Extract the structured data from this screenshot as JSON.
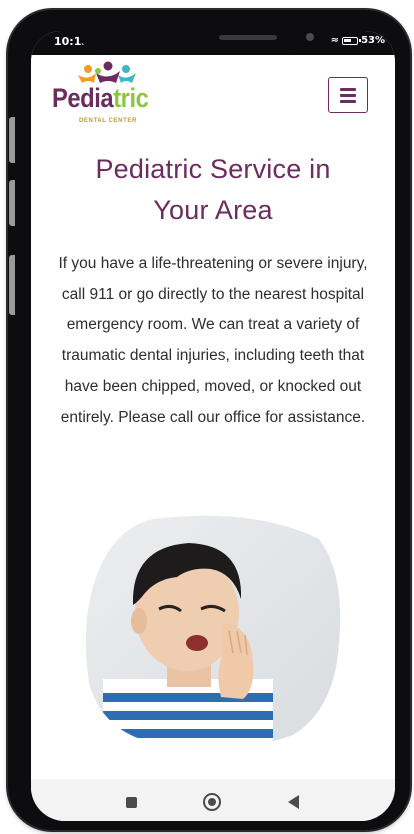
{
  "status_bar": {
    "time": "10:15",
    "battery": "53%",
    "icons": [
      "notification-icon",
      "wifi-icon",
      "battery-icon"
    ]
  },
  "header": {
    "logo_text": "Pediatric",
    "logo_subtitle": "DENTAL CENTER",
    "menu_icon": "hamburger-menu-icon"
  },
  "main": {
    "headline": "Pediatric Service in Your Area",
    "body": "If you have a life-threatening or severe injury, call 911 or go directly to the nearest hospital emergency room. We can treat a variety of traumatic dental injuries, including teeth that have been chipped, moved, or knocked out entirely. Please call our office for assistance.",
    "image": "child-with-toothache-photo"
  },
  "nav_bar": {
    "icons": [
      "recent-apps-icon",
      "home-icon",
      "back-icon"
    ]
  },
  "colors": {
    "brand_purple": "#6b2c5f",
    "logo_gold": "#b99a3f",
    "logo_green": "#8cc63f",
    "logo_orange": "#f39c25",
    "logo_teal": "#3fb6c6",
    "phone_frame": "#0d0d0f"
  }
}
